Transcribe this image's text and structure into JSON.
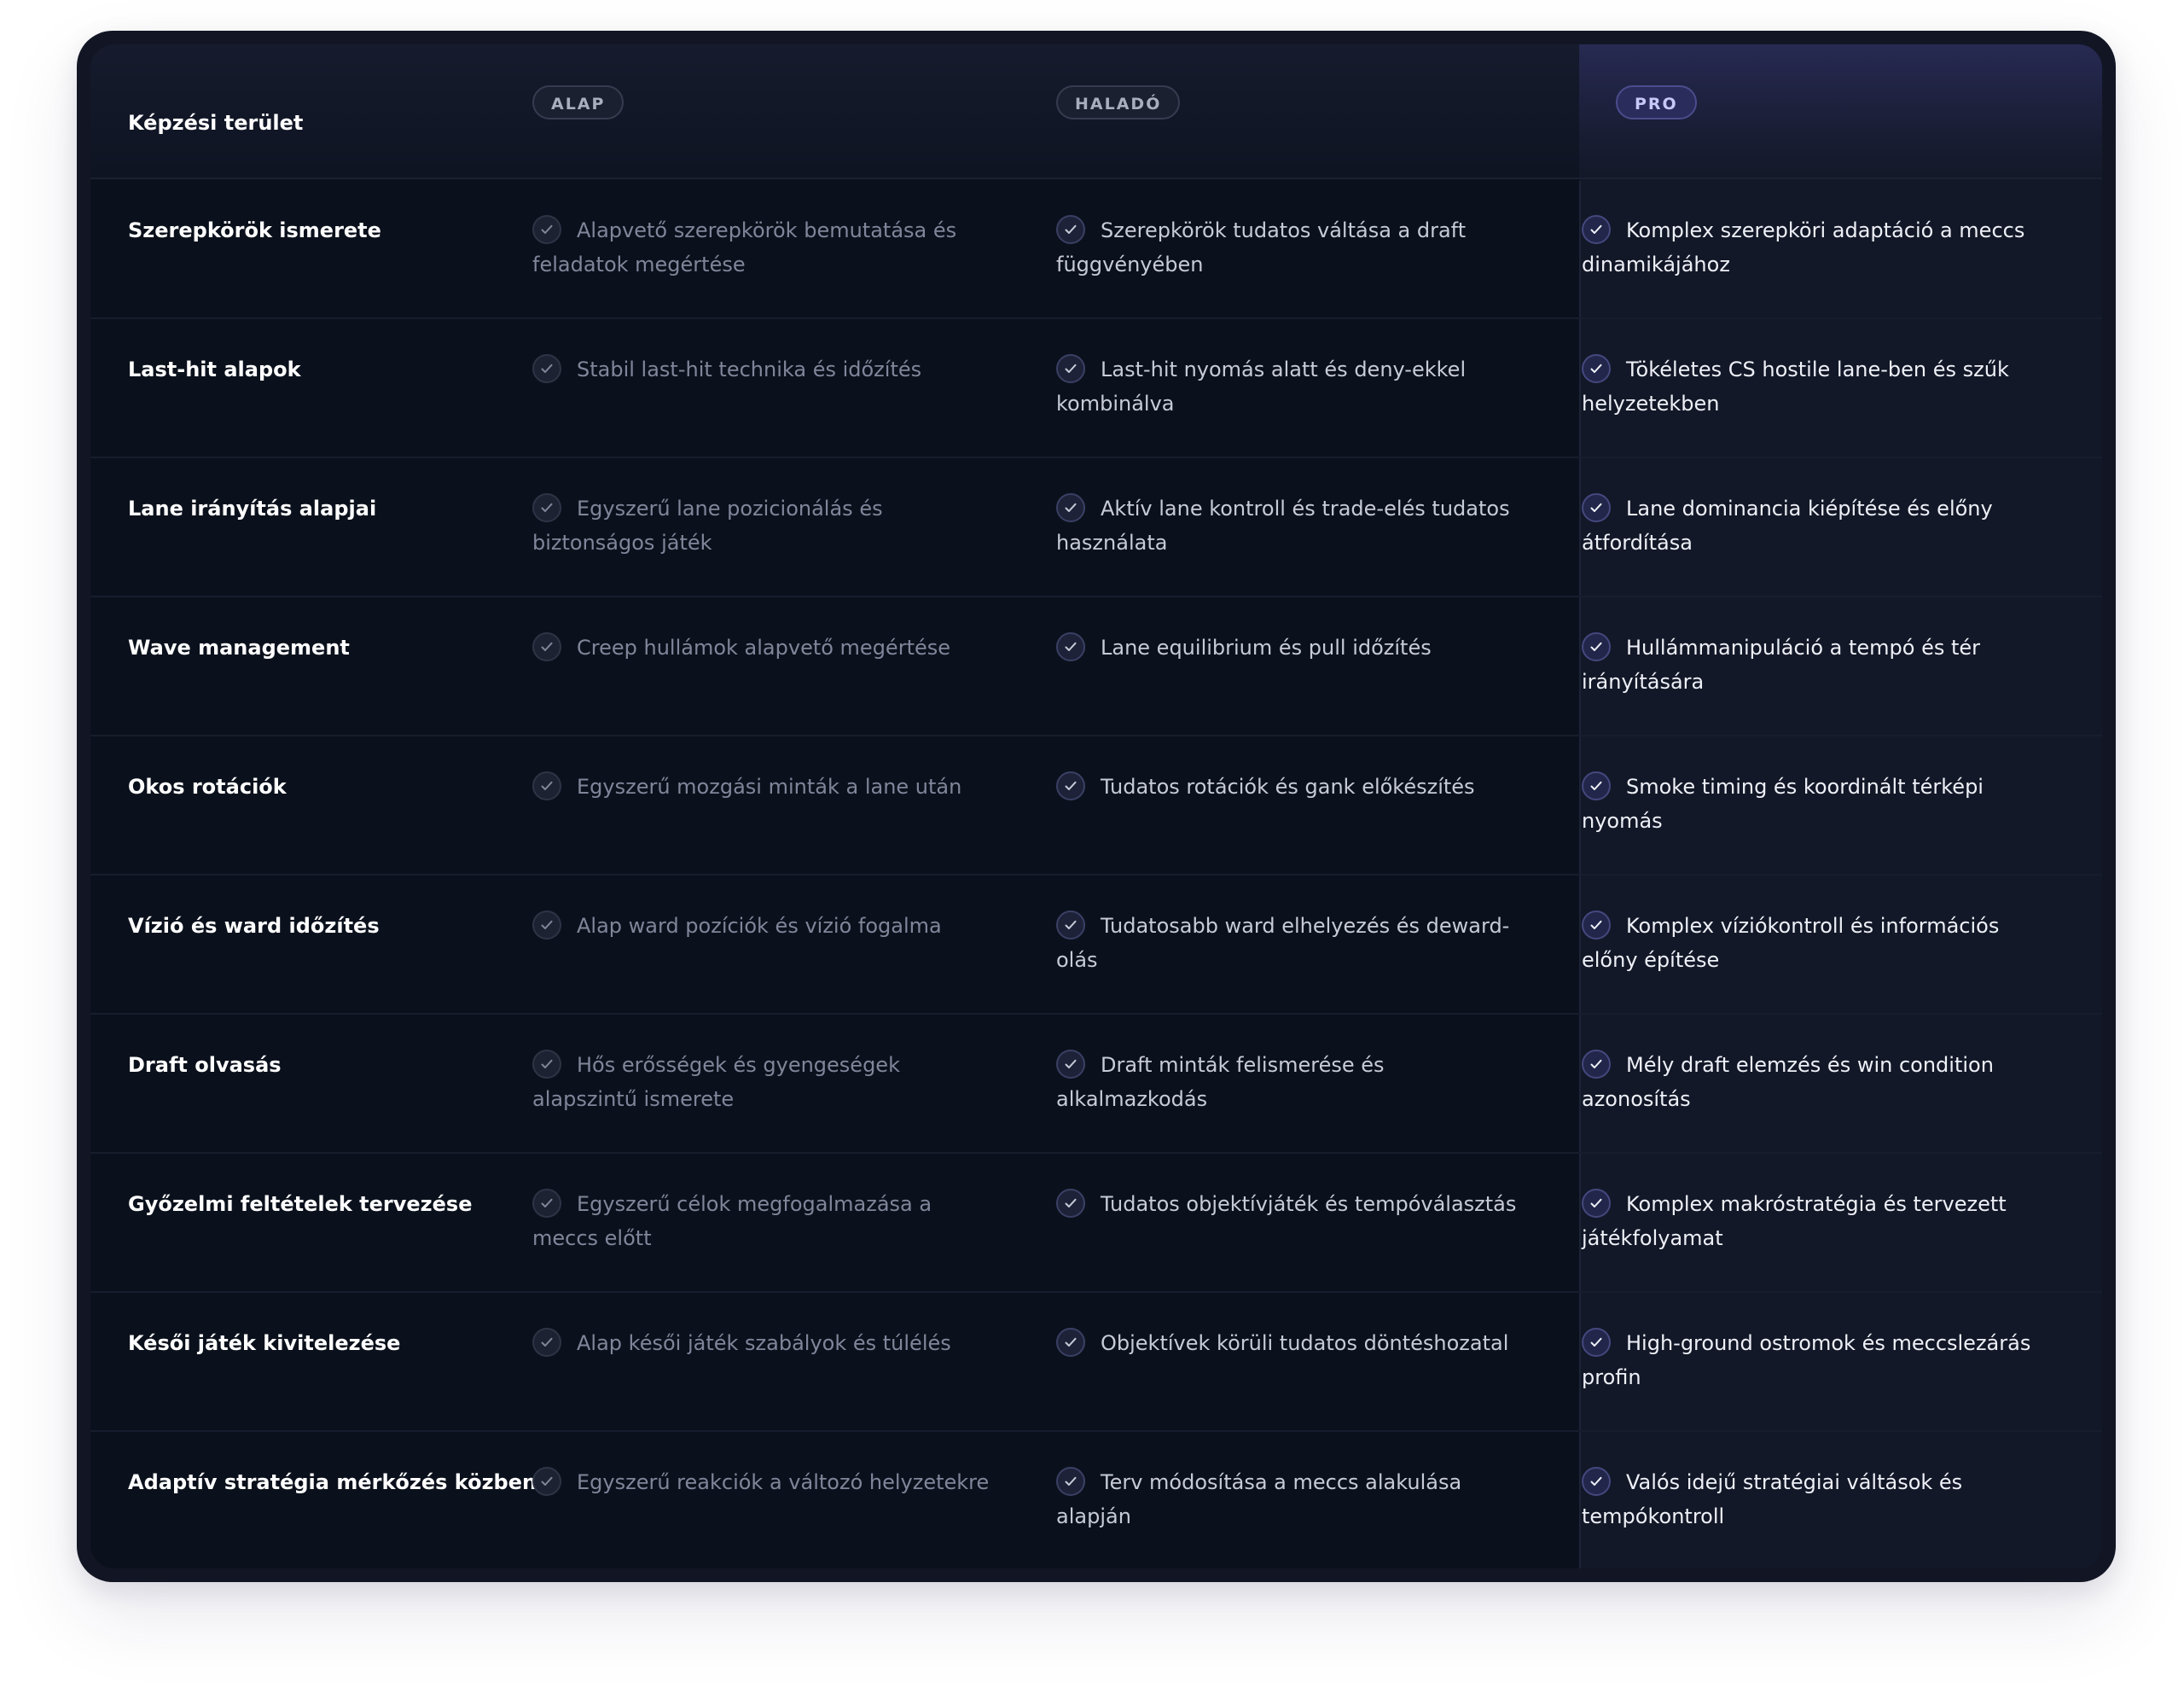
{
  "header": {
    "area_label": "Képzési terület",
    "tiers": [
      {
        "label": "ALAP"
      },
      {
        "label": "HALADÓ"
      },
      {
        "label": "PRO"
      }
    ]
  },
  "rows": [
    {
      "area": "Szerepkörök ismerete",
      "basic": "Alapvető szerepkörök bemutatása és feladatok megértése",
      "mid": "Szerepkörök tudatos váltása a draft függvényében",
      "pro": "Komplex szerepköri adaptáció a meccs dinamikájához"
    },
    {
      "area": "Last-hit alapok",
      "basic": "Stabil last-hit technika és időzítés",
      "mid": "Last-hit nyomás alatt és deny-ekkel kombinálva",
      "pro": "Tökéletes CS hostile lane-ben és szűk helyzetekben"
    },
    {
      "area": "Lane irányítás alapjai",
      "basic": "Egyszerű lane pozicionálás és biztonságos játék",
      "mid": "Aktív lane kontroll és trade-elés tudatos használata",
      "pro": "Lane dominancia kiépítése és előny átfordítása"
    },
    {
      "area": "Wave management",
      "basic": "Creep hullámok alapvető megértése",
      "mid": "Lane equilibrium és pull időzítés",
      "pro": "Hullámmanipuláció a tempó és tér irányítására"
    },
    {
      "area": "Okos rotációk",
      "basic": "Egyszerű mozgási minták a lane után",
      "mid": "Tudatos rotációk és gank előkészítés",
      "pro": "Smoke timing és koordinált térképi nyomás"
    },
    {
      "area": "Vízió és ward időzítés",
      "basic": "Alap ward pozíciók és vízió fogalma",
      "mid": "Tudatosabb ward elhelyezés és deward-olás",
      "pro": "Komplex víziókontroll és információs előny építése"
    },
    {
      "area": "Draft olvasás",
      "basic": "Hős erősségek és gyengeségek alapszintű ismerete",
      "mid": "Draft minták felismerése és alkalmazkodás",
      "pro": "Mély draft elemzés és win condition azonosítás"
    },
    {
      "area": "Győzelmi feltételek tervezése",
      "basic": "Egyszerű célok megfogalmazása a meccs előtt",
      "mid": "Tudatos objektívjáték és tempóválasztás",
      "pro": "Komplex makróstratégia és tervezett játékfolyamat"
    },
    {
      "area": "Késői játék kivitelezése",
      "basic": "Alap késői játék szabályok és túlélés",
      "mid": "Objektívek körüli tudatos döntéshozatal",
      "pro": "High-ground ostromok és meccslezárás profin"
    },
    {
      "area": "Adaptív stratégia mérkőzés közben",
      "basic": "Egyszerű reakciók a változó helyzetekre",
      "mid": "Terv módosítása a meccs alakulása alapján",
      "pro": "Valós idejű stratégiai váltások és tempókontroll"
    }
  ]
}
